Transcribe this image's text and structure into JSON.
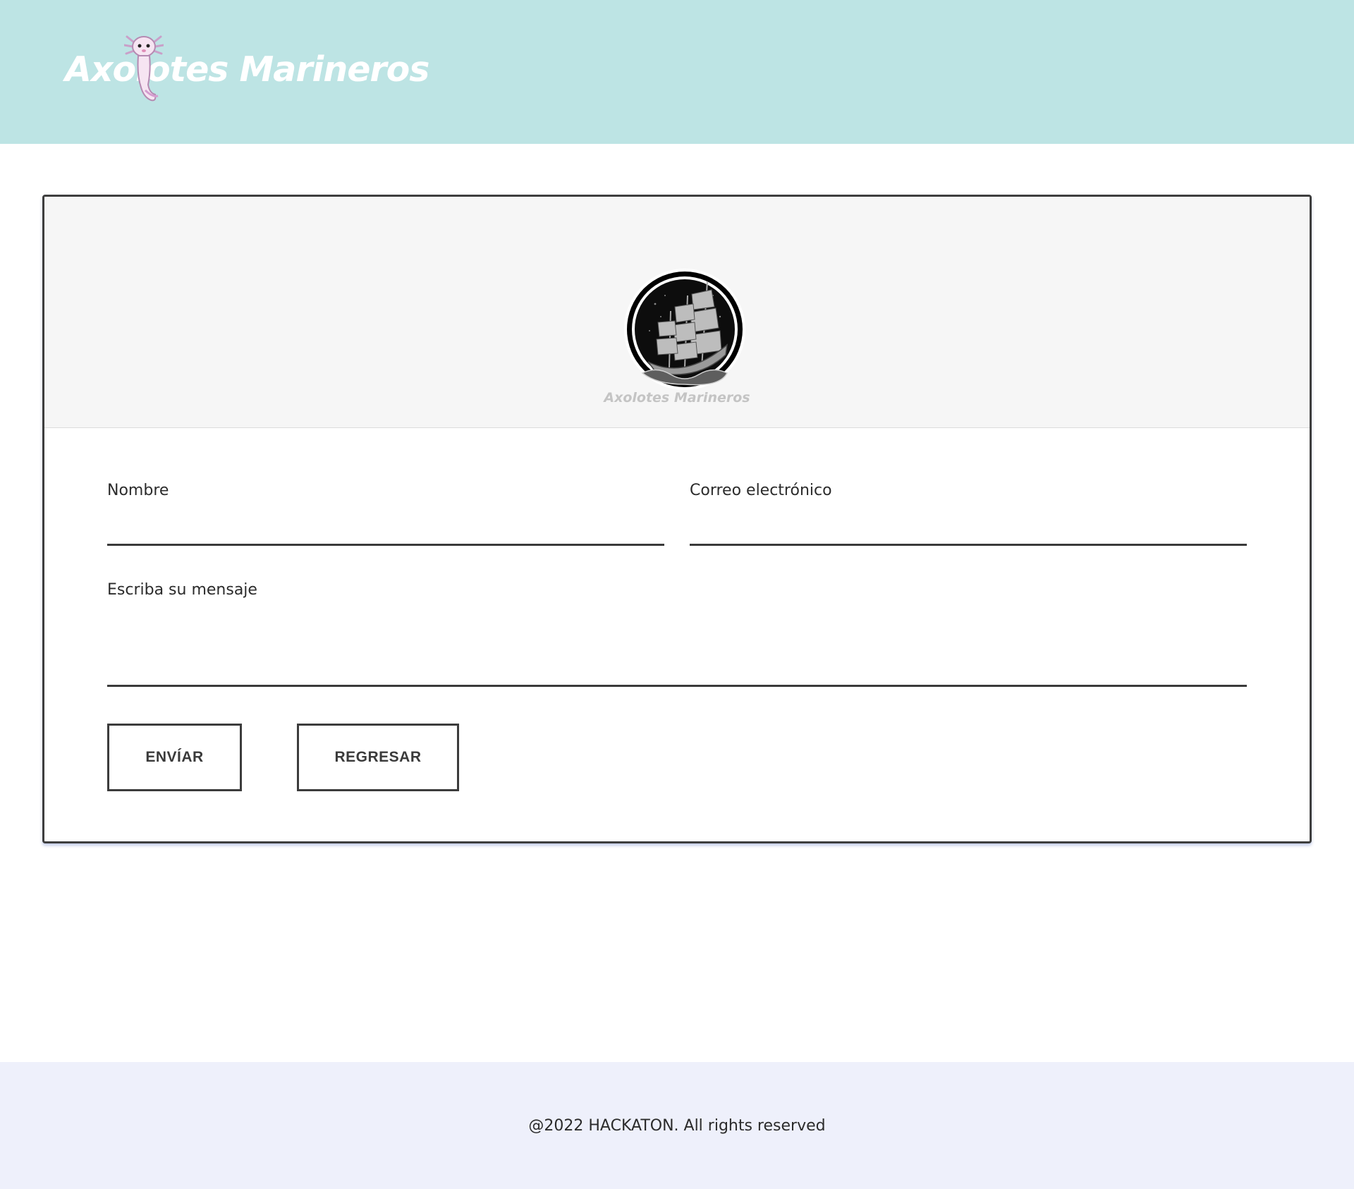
{
  "header": {
    "brand": "Axolotes Marineros",
    "background_color": "#bde4e4",
    "logo_icon": "axolotl-icon"
  },
  "card": {
    "logo_icon": "ship-icon",
    "logo_caption": "Axolotes Marineros",
    "form": {
      "name_label": "Nombre",
      "name_value": "",
      "email_label": "Correo electrónico",
      "email_value": "",
      "message_label": "Escriba su mensaje",
      "message_value": "",
      "submit_label": "ENVÍAR",
      "back_label": "REGRESAR"
    }
  },
  "footer": {
    "text": "@2022 HACKATON. All rights reserved",
    "background_color": "#eef0fb"
  }
}
